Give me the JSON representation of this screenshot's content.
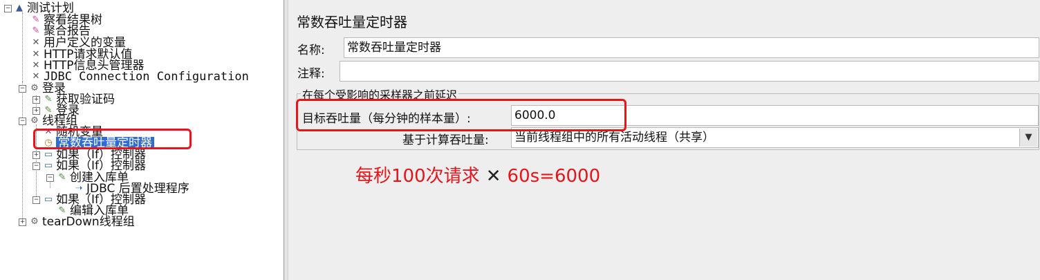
{
  "tree": {
    "items": [
      {
        "label": "测试计划",
        "icon": "test-plan-icon"
      },
      {
        "label": "察看结果树",
        "icon": "listener-icon"
      },
      {
        "label": "聚合报告",
        "icon": "listener-icon"
      },
      {
        "label": "用户定义的变量",
        "icon": "config-element-icon"
      },
      {
        "label": "HTTP请求默认值",
        "icon": "config-element-icon"
      },
      {
        "label": "HTTP信息头管理器",
        "icon": "config-element-icon"
      },
      {
        "label": "JDBC Connection Configuration",
        "icon": "config-element-icon"
      },
      {
        "label": "登录",
        "icon": "thread-group-icon"
      },
      {
        "label": "获取验证码",
        "icon": "sampler-icon"
      },
      {
        "label": "登录",
        "icon": "sampler-icon"
      },
      {
        "label": "线程组",
        "icon": "thread-group-icon"
      },
      {
        "label": "随机变量",
        "icon": "config-element-icon"
      },
      {
        "label": "常数吞吐量定时器",
        "icon": "timer-icon"
      },
      {
        "label": "如果（If）控制器",
        "icon": "controller-icon"
      },
      {
        "label": "如果（If）控制器",
        "icon": "controller-icon"
      },
      {
        "label": "创建入库单",
        "icon": "sampler-icon"
      },
      {
        "label": "JDBC 后置处理程序",
        "icon": "post-processor-icon"
      },
      {
        "label": "如果（If）控制器",
        "icon": "controller-icon"
      },
      {
        "label": "编辑入库单",
        "icon": "sampler-icon"
      },
      {
        "label": "tearDown线程组",
        "icon": "thread-group-icon"
      }
    ]
  },
  "panel": {
    "title": "常数吞吐量定时器",
    "name_label": "名称:",
    "name_value": "常数吞吐量定时器",
    "comment_label": "注释:",
    "comment_value": "",
    "group_title": "在每个受影响的采样器之前延迟",
    "throughput_label": "目标吞吐量（每分钟的样本量）:",
    "throughput_value": "6000.0",
    "based_on_label": "基于计算吞吐量:",
    "based_on_value": "当前线程组中的所有活动线程（共享）"
  },
  "annotation": {
    "prefix": "每秒100次请求",
    "suffix": "60s=6000",
    "color": "#e8141a"
  },
  "colors": {
    "selection": "#2d6cd2",
    "panel_bg": "#eeeeee",
    "highlight_red": "#e8141a"
  }
}
